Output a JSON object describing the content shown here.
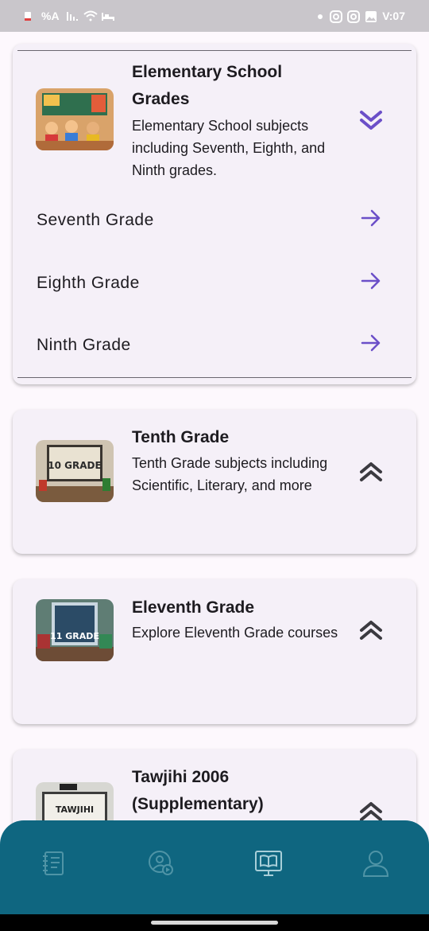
{
  "status_bar": {
    "left_text": "%A",
    "right_text": "V:07"
  },
  "cards": [
    {
      "title": "Elementary School Grades",
      "description": "Elementary School subjects including Seventh, Eighth, and Ninth grades.",
      "expanded": true,
      "subitems": [
        "Seventh Grade",
        "Eighth Grade",
        "Ninth Grade"
      ]
    },
    {
      "title": "Tenth Grade",
      "description": "Tenth Grade subjects including Scientific, Literary, and more",
      "expanded": false
    },
    {
      "title": "Eleventh Grade",
      "description": "Explore Eleventh Grade courses",
      "expanded": false
    },
    {
      "title": "Tawjihi 2006 (Supplementary)",
      "expanded": false
    }
  ],
  "thumbnails": {
    "tenth": "10 GRADE",
    "eleventh": "11 GRADE",
    "tawjihi": "TAWJIHI"
  },
  "bottom_nav": {
    "items": [
      "notebook-icon",
      "profile-video-icon",
      "classroom-icon",
      "user-icon"
    ],
    "active_index": 2
  },
  "colors": {
    "accent": "#6b4fc8",
    "chevron_dark": "#3b3a40",
    "nav_bg": "#0f6680",
    "nav_icon": "#4f94a6",
    "nav_icon_active": "#a8cfd9"
  }
}
